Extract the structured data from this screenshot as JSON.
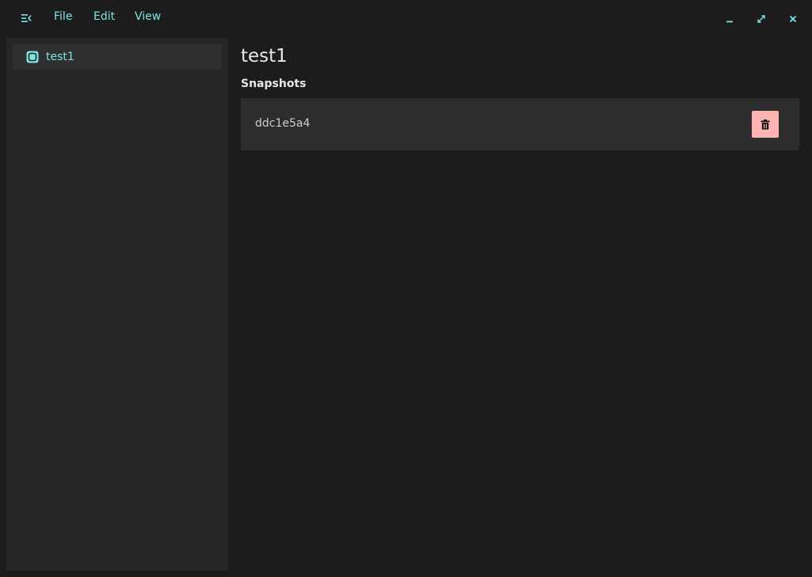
{
  "colors": {
    "background": "#1c1c1c",
    "sidebar": "#262626",
    "selected_item": "#303030",
    "row": "#2d2d2d",
    "accent": "#7de3e3",
    "danger": "#ffb3b3"
  },
  "titlebar": {
    "menu_toggle_icon": "menu-collapse-icon",
    "menus": [
      "File",
      "Edit",
      "View"
    ],
    "window_controls": {
      "minimize_icon": "minimize-icon",
      "maximize_icon": "maximize-icon",
      "close_icon": "close-icon"
    }
  },
  "sidebar": {
    "items": [
      {
        "label": "test1",
        "icon": "volume-icon",
        "selected": true
      }
    ]
  },
  "main": {
    "title": "test1",
    "section_title": "Snapshots",
    "snapshots": [
      {
        "id": "ddc1e5a4",
        "delete_icon": "trash-icon"
      }
    ]
  }
}
